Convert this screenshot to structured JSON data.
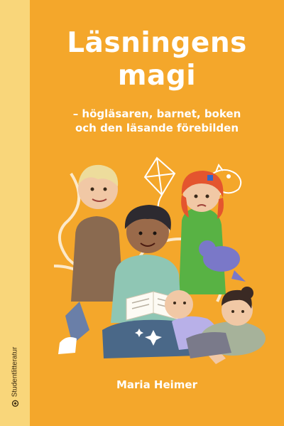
{
  "book": {
    "title_line1": "Läsningens",
    "title_line2": "magi",
    "subtitle_line1": "– högläsaren, barnet, boken",
    "subtitle_line2": "och den läsande förebilden",
    "author": "Maria Heimer",
    "publisher": "Studentlitteratur",
    "publisher_icon": "studentlitteratur-logo-icon"
  },
  "colors": {
    "cover_background": "#f4a72b",
    "spine": "#f9d67a",
    "title_text": "#ffffff"
  }
}
